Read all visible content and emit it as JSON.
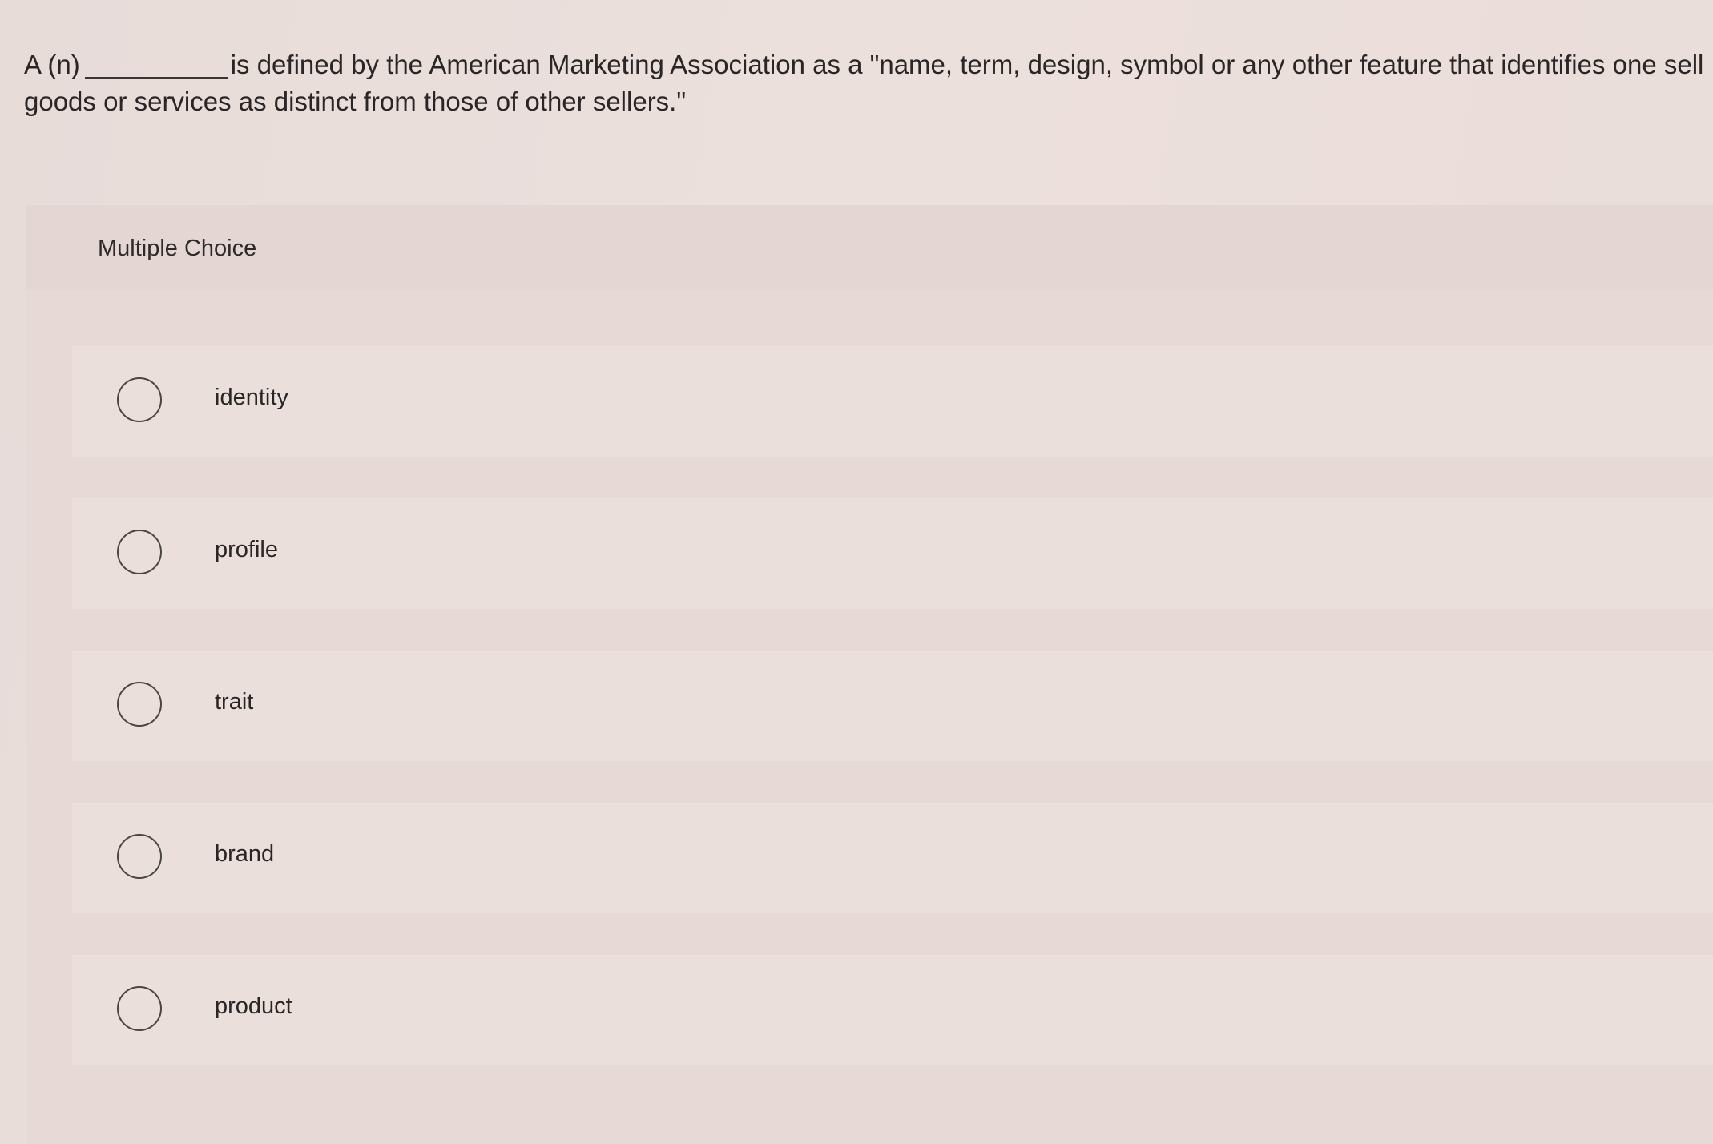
{
  "question": {
    "prefix": "A (n)",
    "line1_rest": "is defined by the American Marketing Association as a \"name, term, design, symbol or any other feature that identifies one sell",
    "line2": "goods or services as distinct from those of other sellers.\""
  },
  "panel": {
    "header_label": "Multiple Choice"
  },
  "options": [
    {
      "label": "identity"
    },
    {
      "label": "profile"
    },
    {
      "label": "trait"
    },
    {
      "label": "brand"
    },
    {
      "label": "product"
    }
  ]
}
